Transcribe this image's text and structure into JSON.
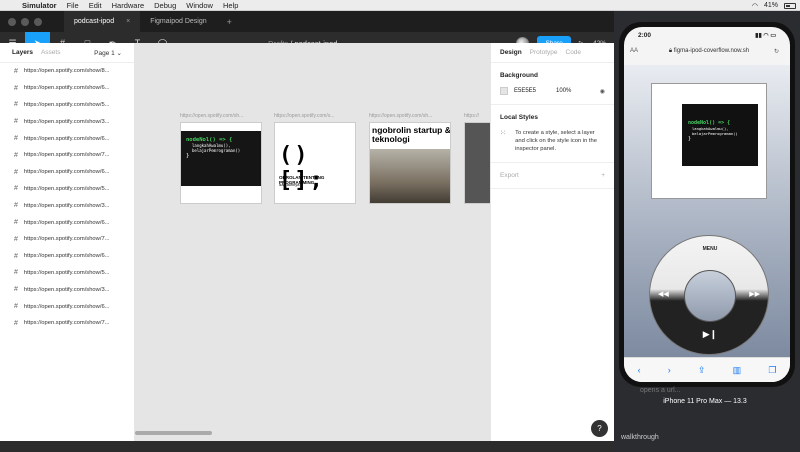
{
  "menubar": {
    "app": "Simulator",
    "items": [
      "File",
      "Edit",
      "Hardware",
      "Debug",
      "Window",
      "Help"
    ],
    "battery": "41%"
  },
  "figma": {
    "tabs": [
      {
        "label": "podcast-ipod",
        "close": "×",
        "active": true
      },
      {
        "label": "Figmaipod Design",
        "active": false
      }
    ],
    "new_tab": "+",
    "breadcrumb": {
      "parent": "Drafts",
      "separator": "/",
      "file": "podcast-ipod",
      "chevron": "⌄"
    },
    "share": "Share",
    "zoom": "42%",
    "left": {
      "tab_layers": "Layers",
      "tab_assets": "Assets",
      "page": "Page 1 ⌄",
      "layers": [
        "https://open.spotify.com/show/8...",
        "https://open.spotify.com/show/6...",
        "https://open.spotify.com/show/5...",
        "https://open.spotify.com/show/3...",
        "https://open.spotify.com/show/6...",
        "https://open.spotify.com/show/7...",
        "https://open.spotify.com/show/6...",
        "https://open.spotify.com/show/5...",
        "https://open.spotify.com/show/3...",
        "https://open.spotify.com/show/6...",
        "https://open.spotify.com/show/7...",
        "https://open.spotify.com/show/6...",
        "https://open.spotify.com/show/5...",
        "https://open.spotify.com/show/3...",
        "https://open.spotify.com/show/6...",
        "https://open.spotify.com/show/7..."
      ]
    },
    "canvas": {
      "frames": [
        {
          "label": "https://open.spotify.com/sh..."
        },
        {
          "label": "https://open.spotify.com/s..."
        },
        {
          "label": "https://open.spotify.com/sh..."
        },
        {
          "label": "https://"
        }
      ],
      "code_l1": "nodeNol() => {",
      "code_l2a": "langkahAwalmu(),",
      "code_l2b": "belajarPemrograman()",
      "code_l3": "}",
      "brackets": "()[];",
      "brackets_sub": "OBROLAN TENTANG PROGRAMMING",
      "brackets_sub2": "dan lainnya",
      "photo_title": "ngobrolin startup & teknologi"
    },
    "right": {
      "tab_design": "Design",
      "tab_prototype": "Prototype",
      "tab_code": "Code",
      "background_title": "Background",
      "bg_hex": "E5E5E5",
      "bg_opacity": "100%",
      "local_styles_title": "Local Styles",
      "local_styles_text": "To create a style, select a layer and click on the style icon in the inspector panel.",
      "export_title": "Export",
      "export_plus": "+"
    },
    "help": "?"
  },
  "simulator": {
    "time": "2:00",
    "url": "figma-ipod-coverflow.now.sh",
    "aa": "AA",
    "device_label": "iPhone 11 Pro Max — 13.3",
    "under_text": "opens a url...",
    "menu_text": "MENU",
    "walkthrough": "walkthrough"
  }
}
